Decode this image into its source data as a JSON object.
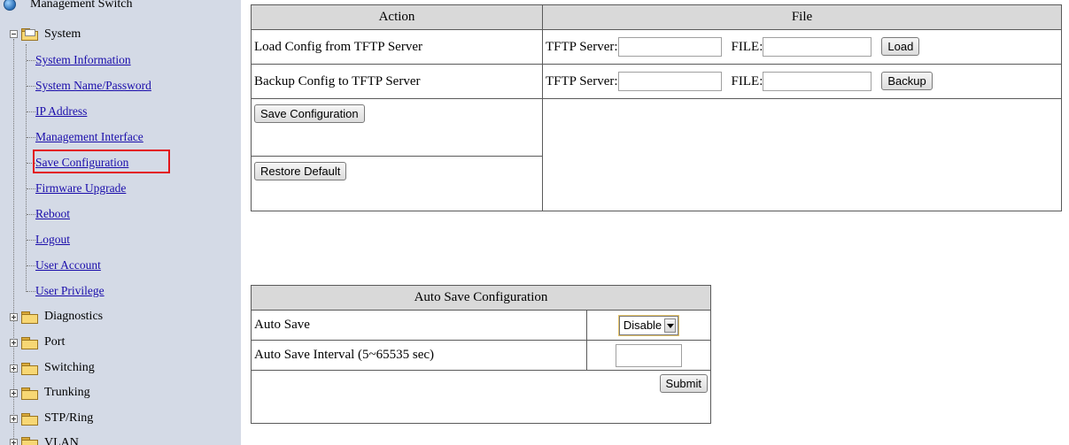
{
  "sidebar": {
    "root": "Management Switch",
    "system_folder": "System",
    "system_items": [
      "System Information",
      "System Name/Password",
      "IP Address",
      "Management Interface",
      "Save Configuration",
      "Firmware Upgrade",
      "Reboot",
      "Logout",
      "User Account",
      "User Privilege"
    ],
    "other_folders": [
      "Diagnostics",
      "Port",
      "Switching",
      "Trunking",
      "STP/Ring",
      "VLAN"
    ],
    "highlighted_item": "Save Configuration",
    "highlight_color": "#e3151a"
  },
  "config_table": {
    "header_action": "Action",
    "header_file": "File",
    "load_label": "Load Config from TFTP Server",
    "backup_label": "Backup Config to TFTP Server",
    "tftp_server_label": "TFTP Server:",
    "file_label": "FILE:",
    "load_button": "Load",
    "backup_button": "Backup",
    "save_button": "Save Configuration",
    "restore_button": "Restore Default"
  },
  "auto_save": {
    "title": "Auto Save Configuration",
    "auto_save_label": "Auto Save",
    "auto_save_value": "Disable",
    "interval_label": "Auto Save Interval (5~65535 sec)",
    "interval_value": "",
    "submit_button": "Submit"
  },
  "colors": {
    "sidebar_bg": "#d4dae6",
    "link": "#1a0dab",
    "header_bg": "#d9d9d9"
  }
}
